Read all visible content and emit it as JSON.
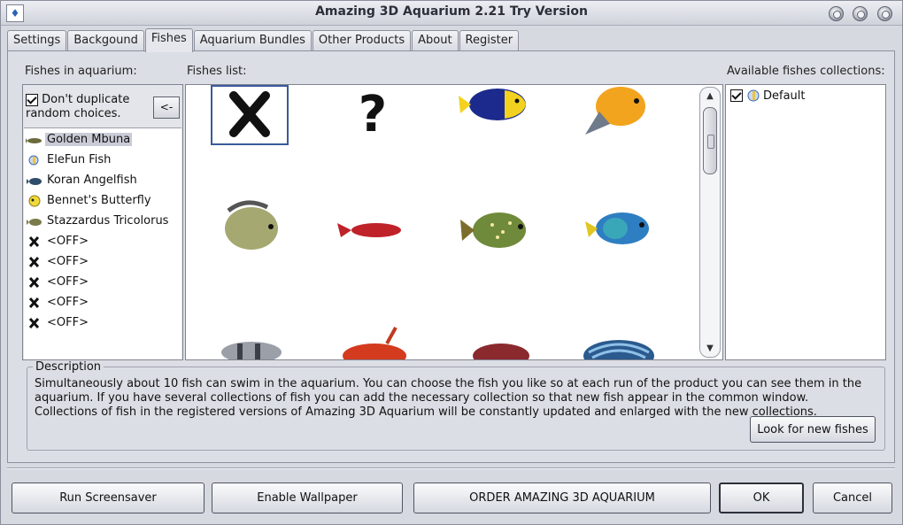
{
  "window": {
    "title": "Amazing 3D Aquarium 2.21 Try Version"
  },
  "tabs": [
    {
      "label": "Settings",
      "active": false
    },
    {
      "label": "Backgound",
      "active": false
    },
    {
      "label": "Fishes",
      "active": true
    },
    {
      "label": "Aquarium Bundles",
      "active": false
    },
    {
      "label": "Other Products",
      "active": false
    },
    {
      "label": "About",
      "active": false
    },
    {
      "label": "Register",
      "active": false
    }
  ],
  "left": {
    "title": "Fishes in aquarium:",
    "dont_duplicate_label": "Don't duplicate random choices.",
    "dont_duplicate_checked": true,
    "move_button": "<-",
    "items": [
      {
        "label": "Golden Mbuna",
        "icon": "golden-mbuna-icon",
        "selected": true
      },
      {
        "label": "EleFun Fish",
        "icon": "elefun-fish-icon",
        "selected": false
      },
      {
        "label": "Koran Angelfish",
        "icon": "koran-angelfish-icon",
        "selected": false
      },
      {
        "label": "Bennet's Butterfly",
        "icon": "bennets-butterfly-icon",
        "selected": false
      },
      {
        "label": "Stazzardus Tricolorus",
        "icon": "stazzardus-icon",
        "selected": false
      },
      {
        "label": "<OFF>",
        "icon": "off-x-icon",
        "selected": false
      },
      {
        "label": "<OFF>",
        "icon": "off-x-icon",
        "selected": false
      },
      {
        "label": "<OFF>",
        "icon": "off-x-icon",
        "selected": false
      },
      {
        "label": "<OFF>",
        "icon": "off-x-icon",
        "selected": false
      },
      {
        "label": "<OFF>",
        "icon": "off-x-icon",
        "selected": false
      }
    ]
  },
  "grid": {
    "title": "Fishes list:",
    "cells": [
      {
        "icon": "off-x-icon",
        "selected": true
      },
      {
        "icon": "random-question-icon"
      },
      {
        "icon": "yellow-blue-fish-icon"
      },
      {
        "icon": "orange-fish-icon"
      },
      {
        "icon": "grey-fish-icon"
      },
      {
        "icon": "red-slim-fish-icon"
      },
      {
        "icon": "spotted-fish-icon"
      },
      {
        "icon": "blue-angelfish-icon"
      },
      {
        "icon": "striped-fish-icon"
      },
      {
        "icon": "red-fin-fish-icon"
      },
      {
        "icon": "dark-red-fish-icon"
      },
      {
        "icon": "blue-striped-fish-icon"
      }
    ]
  },
  "collections": {
    "title": "Available fishes collections:",
    "items": [
      {
        "label": "Default",
        "checked": true
      }
    ]
  },
  "description": {
    "legend": "Description",
    "text": "Simultaneously about 10 fish can swim in the aquarium. You can choose the fish you like so at each run of the product you can see them in the aquarium. If you have several collections of fish you can add the necessary collection so that new fish appear in the common window. Collections of fish in the registered versions of Amazing 3D Aquarium will be constantly updated and enlarged with the new collections.",
    "look_button": "Look for new fishes"
  },
  "footer": {
    "run": "Run Screensaver",
    "wallpaper": "Enable Wallpaper",
    "order": "ORDER AMAZING 3D AQUARIUM",
    "ok": "OK",
    "cancel": "Cancel"
  },
  "colors": {
    "window_bg": "#d7d9e1",
    "accent": "#3a5a9a"
  }
}
